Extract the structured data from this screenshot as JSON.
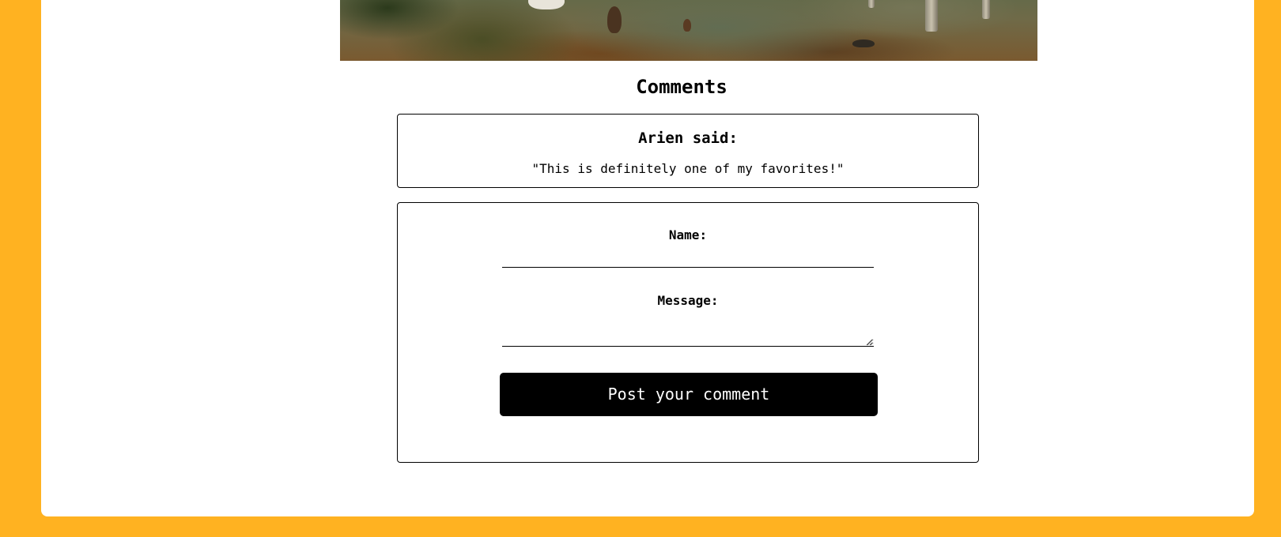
{
  "artwork": {
    "description_icon": "painting-image"
  },
  "comments": {
    "heading": "Comments",
    "items": [
      {
        "author_line": "Arien said:",
        "text": "\"This is definitely one of my favorites!\""
      }
    ]
  },
  "form": {
    "name_label": "Name:",
    "name_value": "",
    "message_label": "Message:",
    "message_value": "",
    "submit_label": "Post your comment"
  },
  "colors": {
    "page_background": "#FFB221",
    "card_background": "#FFFFFF",
    "button_background": "#000000",
    "button_text": "#FFFFFF"
  }
}
